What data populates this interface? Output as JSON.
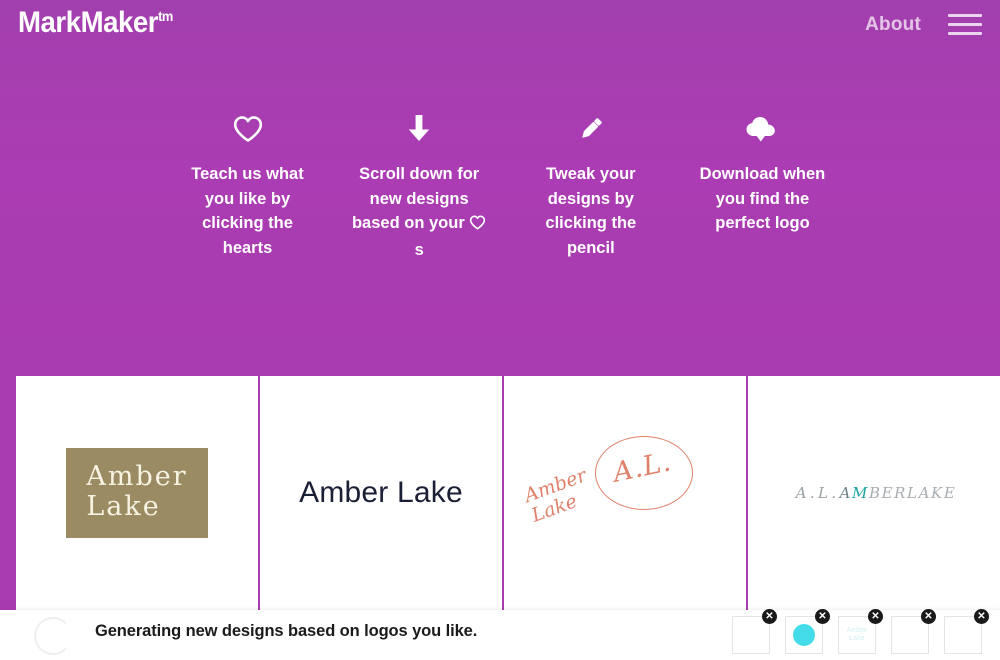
{
  "header": {
    "brand_name": "MarkMaker",
    "brand_tm": "tm",
    "about_label": "About",
    "menu_icon": "hamburger-menu-icon"
  },
  "instructions": [
    {
      "icon": "heart-icon",
      "text": "Teach us what you like by clicking the hearts"
    },
    {
      "icon": "arrow-down-icon",
      "text_before": "Scroll down for new designs based on your",
      "text_after": "s"
    },
    {
      "icon": "pencil-icon",
      "text": "Tweak your designs by clicking the pencil"
    },
    {
      "icon": "cloud-download-icon",
      "text": "Download when you find the perfect logo"
    }
  ],
  "logos": [
    {
      "name": "amber-lake-boxed",
      "line1": "Amber",
      "line2": "Lake",
      "box_color": "#9a8b62",
      "text_color": "#f7f3e3"
    },
    {
      "name": "amber-lake-plain",
      "text": "Amber Lake",
      "text_color": "#1b1f35"
    },
    {
      "name": "amber-lake-monogram",
      "monogram": "A.L.",
      "line1": "Amber",
      "line2": "Lake",
      "color": "#e0816b"
    },
    {
      "name": "amber-lake-serif-caps",
      "prefix": "A.L.",
      "part1": "A",
      "part2": "M",
      "part3": "BERLAKE",
      "accent_color": "#18a3a0",
      "text_color": "#8e9497"
    }
  ],
  "status": {
    "message": "Generating new designs based on logos you like.",
    "spinner": "loading-spinner-icon"
  },
  "liked_thumbnails": [
    {
      "name": "liked-thumb-1",
      "kind": "blank",
      "remove_label": "✕"
    },
    {
      "name": "liked-thumb-2",
      "kind": "circle",
      "color": "#45dcea",
      "remove_label": "✕"
    },
    {
      "name": "liked-thumb-3",
      "kind": "text",
      "line1": "Amber",
      "line2": "Lake",
      "remove_label": "✕"
    },
    {
      "name": "liked-thumb-4",
      "kind": "blank",
      "remove_label": "✕"
    },
    {
      "name": "liked-thumb-5",
      "kind": "blank",
      "remove_label": "✕"
    }
  ],
  "theme": {
    "purple": "#a93bb0",
    "white": "#ffffff"
  }
}
